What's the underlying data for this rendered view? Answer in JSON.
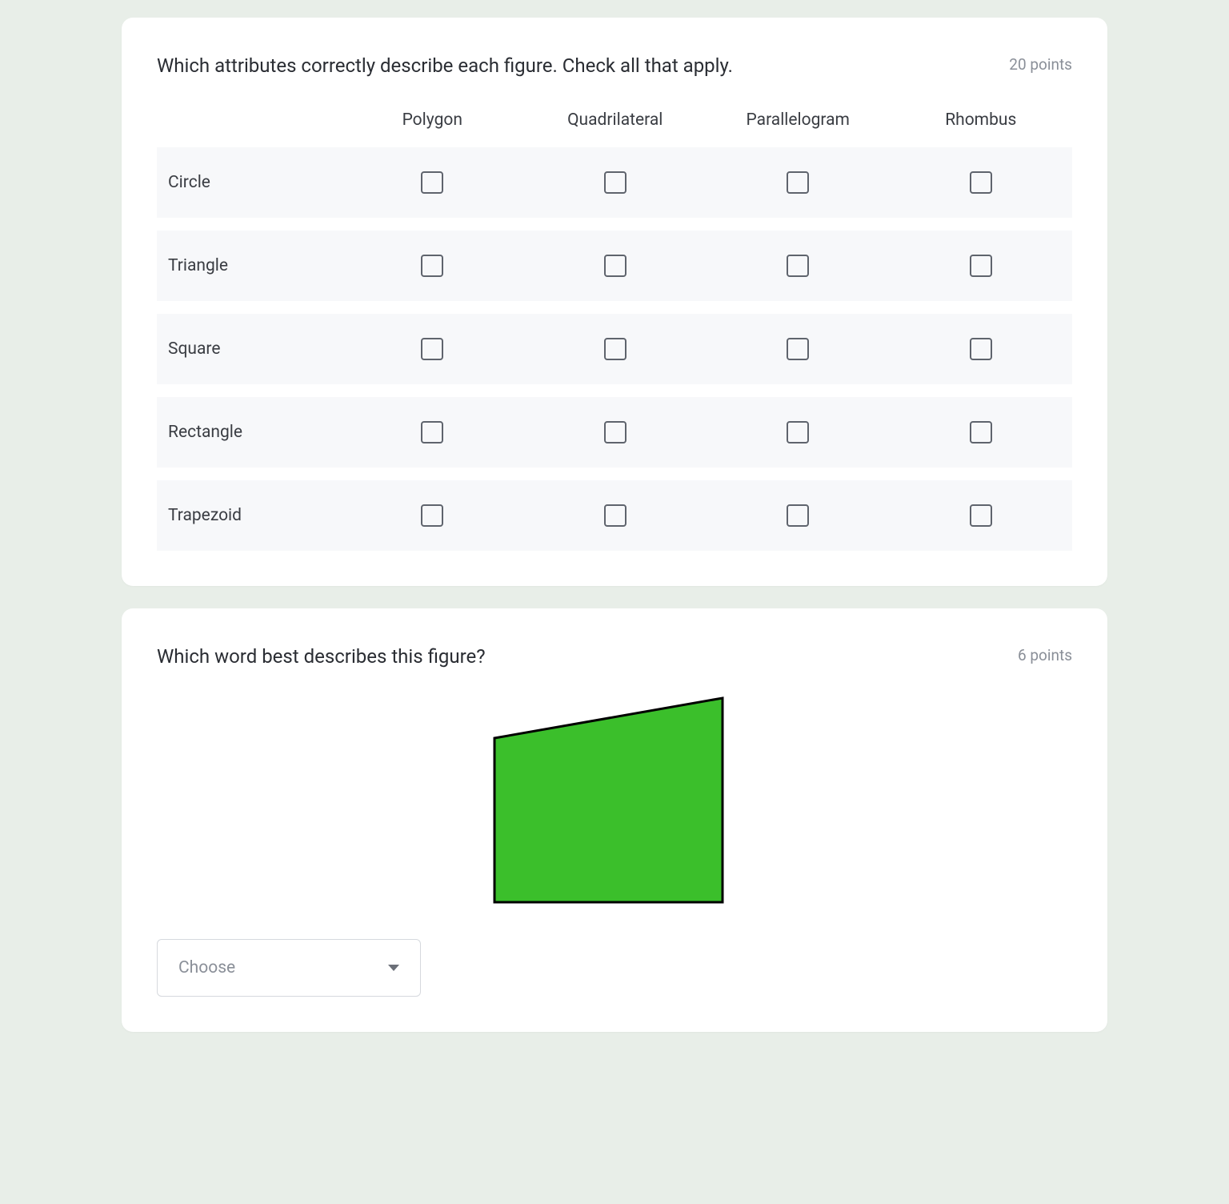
{
  "question1": {
    "text": "Which attributes correctly describe each figure. Check all that apply.",
    "points": "20 points",
    "columns": [
      "Polygon",
      "Quadrilateral",
      "Parallelogram",
      "Rhombus"
    ],
    "rows": [
      "Circle",
      "Triangle",
      "Square",
      "Rectangle",
      "Trapezoid"
    ]
  },
  "question2": {
    "text": "Which word best describes this figure?",
    "points": "6 points",
    "dropdown_label": "Choose",
    "figure": {
      "fill": "#3bbf2b",
      "stroke": "#000000"
    }
  }
}
